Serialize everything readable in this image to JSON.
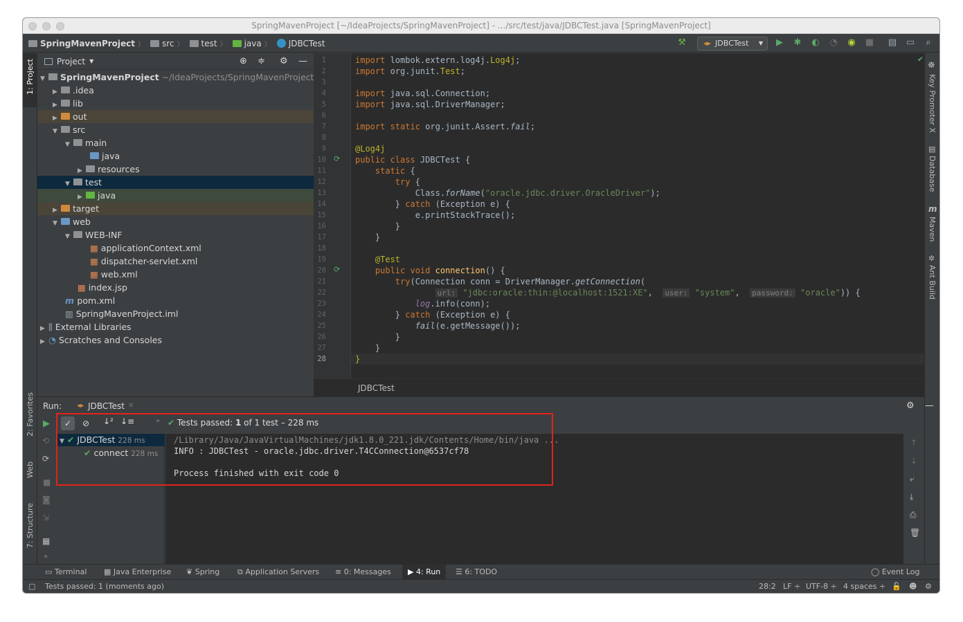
{
  "window": {
    "title": "SpringMavenProject [~/IdeaProjects/SpringMavenProject] - .../src/test/java/JDBCTest.java [SpringMavenProject]"
  },
  "breadcrumb": [
    "SpringMavenProject",
    "src",
    "test",
    "java",
    "JDBCTest"
  ],
  "toolbar": {
    "run_config": "JDBCTest"
  },
  "left_strip": {
    "project": "1: Project",
    "favorites": "2: Favorites",
    "web": "Web",
    "structure": "7: Structure"
  },
  "right_strip": {
    "key_promoter": "Key Promoter X",
    "database": "Database",
    "maven": "Maven",
    "ant_build": "Ant Build"
  },
  "project_panel": {
    "title": "Project",
    "tree": [
      {
        "label": "SpringMavenProject",
        "path": "~/IdeaProjects/SpringMavenProject"
      },
      {
        "label": ".idea"
      },
      {
        "label": "lib"
      },
      {
        "label": "out"
      },
      {
        "label": "src"
      },
      {
        "label": "main"
      },
      {
        "label": "java"
      },
      {
        "label": "resources"
      },
      {
        "label": "test"
      },
      {
        "label": "java"
      },
      {
        "label": "target"
      },
      {
        "label": "web"
      },
      {
        "label": "WEB-INF"
      },
      {
        "label": "applicationContext.xml"
      },
      {
        "label": "dispatcher-servlet.xml"
      },
      {
        "label": "web.xml"
      },
      {
        "label": "index.jsp"
      },
      {
        "label": "pom.xml"
      },
      {
        "label": "SpringMavenProject.iml"
      },
      {
        "label": "External Libraries"
      },
      {
        "label": "Scratches and Consoles"
      }
    ]
  },
  "editor": {
    "line_numbers": [
      "1",
      "2",
      "3",
      "4",
      "5",
      "6",
      "7",
      "8",
      "9",
      "10",
      "11",
      "12",
      "13",
      "14",
      "15",
      "16",
      "17",
      "18",
      "19",
      "20",
      "21",
      "22",
      "23",
      "24",
      "25",
      "26",
      "27",
      "28"
    ],
    "bottom_label": "JDBCTest",
    "hints": {
      "url": "url:",
      "user": "user:",
      "password": "password:"
    }
  },
  "run_panel": {
    "label": "Run:",
    "tab": "JDBCTest",
    "status_prefix": "Tests passed:",
    "status_count": "1",
    "status_suffix": "of 1 test – 228 ms",
    "tree": [
      {
        "label": "JDBCTest",
        "time": "228 ms"
      },
      {
        "label": "connect",
        "time": "228 ms"
      }
    ],
    "console": [
      "/Library/Java/JavaVirtualMachines/jdk1.8.0_221.jdk/Contents/Home/bin/java ...",
      "INFO : JDBCTest - oracle.jdbc.driver.T4CConnection@6537cf78",
      "",
      "Process finished with exit code 0"
    ]
  },
  "bottom_tabs": [
    "Terminal",
    "Java Enterprise",
    "Spring",
    "Application Servers",
    "0: Messages",
    "4: Run",
    "6: TODO",
    "Event Log"
  ],
  "statusbar": {
    "message": "Tests passed: 1 (moments ago)",
    "position": "28:2",
    "line_sep": "LF ÷",
    "encoding": "UTF-8 ÷",
    "indent": "4 spaces ÷"
  },
  "colors": {
    "accent": "#59a869",
    "highlight_box": "#e2231a",
    "selection": "#0d293e"
  }
}
